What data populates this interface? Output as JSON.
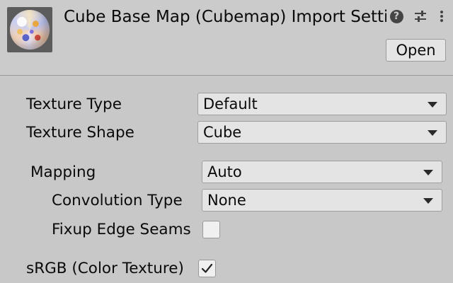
{
  "header": {
    "title": "Cube Base Map (Cubemap) Import Settings",
    "thumbnail_icon": "cubemap-sphere-thumbnail",
    "icons": [
      "help-icon",
      "preset-settings-icon",
      "more-vertical-icon"
    ],
    "open_label": "Open"
  },
  "fields": {
    "texture_type": {
      "label": "Texture Type",
      "value": "Default"
    },
    "texture_shape": {
      "label": "Texture Shape",
      "value": "Cube"
    },
    "mapping": {
      "label": "Mapping",
      "value": "Auto"
    },
    "convolution_type": {
      "label": "Convolution Type",
      "value": "None"
    },
    "fixup_edge_seams": {
      "label": "Fixup Edge Seams",
      "checked": false
    },
    "srgb": {
      "label": "sRGB (Color Texture)",
      "checked": true
    }
  },
  "colors": {
    "background": "#c8c8c8",
    "control": "#e4e4e4",
    "text": "#0a0a0a"
  }
}
